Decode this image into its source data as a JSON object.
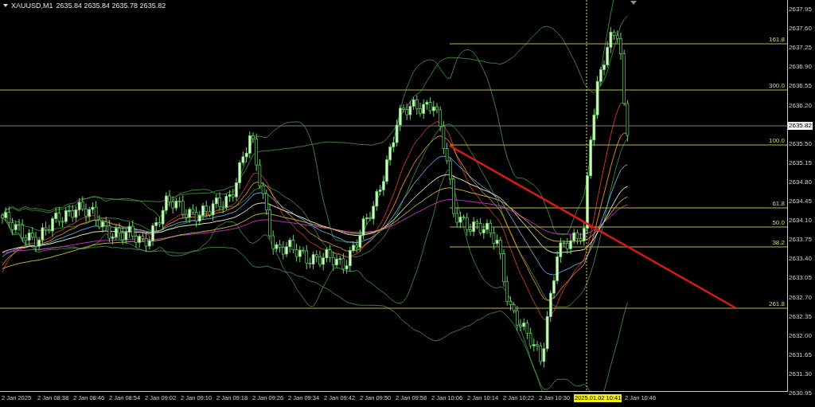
{
  "title": {
    "symbol": "XAUUSD,M1",
    "quotes": "2635.84 2635.84 2635.78 2635.82"
  },
  "price_axis": {
    "ticks": [
      "2637.95",
      "2637.60",
      "2637.25",
      "2636.90",
      "2636.55",
      "2636.20",
      "2635.50",
      "2635.15",
      "2634.80",
      "2634.45",
      "2634.10",
      "2633.75",
      "2633.40",
      "2633.05",
      "2632.70",
      "2632.35",
      "2632.00",
      "2631.65",
      "2631.30",
      "2630.95"
    ],
    "current_price": "2635.82"
  },
  "time_axis": {
    "ticks": [
      {
        "label": "2 Jan 2025",
        "kind": "tick"
      },
      {
        "label": "2 Jan 08:38",
        "kind": "tick"
      },
      {
        "label": "2 Jan 08:46",
        "kind": "tick"
      },
      {
        "label": "2 Jan 08:54",
        "kind": "tick"
      },
      {
        "label": "2 Jan 09:02",
        "kind": "tick"
      },
      {
        "label": "2 Jan 09:10",
        "kind": "tick"
      },
      {
        "label": "2 Jan 09:18",
        "kind": "tick"
      },
      {
        "label": "2 Jan 09:26",
        "kind": "tick"
      },
      {
        "label": "2 Jan 09:34",
        "kind": "tick"
      },
      {
        "label": "2 Jan 09:42",
        "kind": "tick"
      },
      {
        "label": "2 Jan 09:50",
        "kind": "tick"
      },
      {
        "label": "2 Jan 09:58",
        "kind": "tick"
      },
      {
        "label": "2 Jan 10:06",
        "kind": "tick"
      },
      {
        "label": "2 Jan 10:14",
        "kind": "tick"
      },
      {
        "label": "2 Jan 10:22",
        "kind": "tick"
      },
      {
        "label": "2 Jan 10:30",
        "kind": "tick"
      },
      {
        "label": "2025.01.02 10:41",
        "kind": "cursor"
      },
      {
        "label": "2 Jan 10:46",
        "kind": "tick"
      }
    ]
  },
  "fibonacci": {
    "levels": [
      {
        "label": "161.8",
        "kind": "partial"
      },
      {
        "label": "300.0",
        "kind": "full"
      },
      {
        "label": "100.0",
        "kind": "partial"
      },
      {
        "label": "61.8",
        "kind": "partial"
      },
      {
        "label": "50.0",
        "kind": "partial"
      },
      {
        "label": "38.2",
        "kind": "partial"
      },
      {
        "label": "261.8",
        "kind": "full"
      }
    ]
  }
}
